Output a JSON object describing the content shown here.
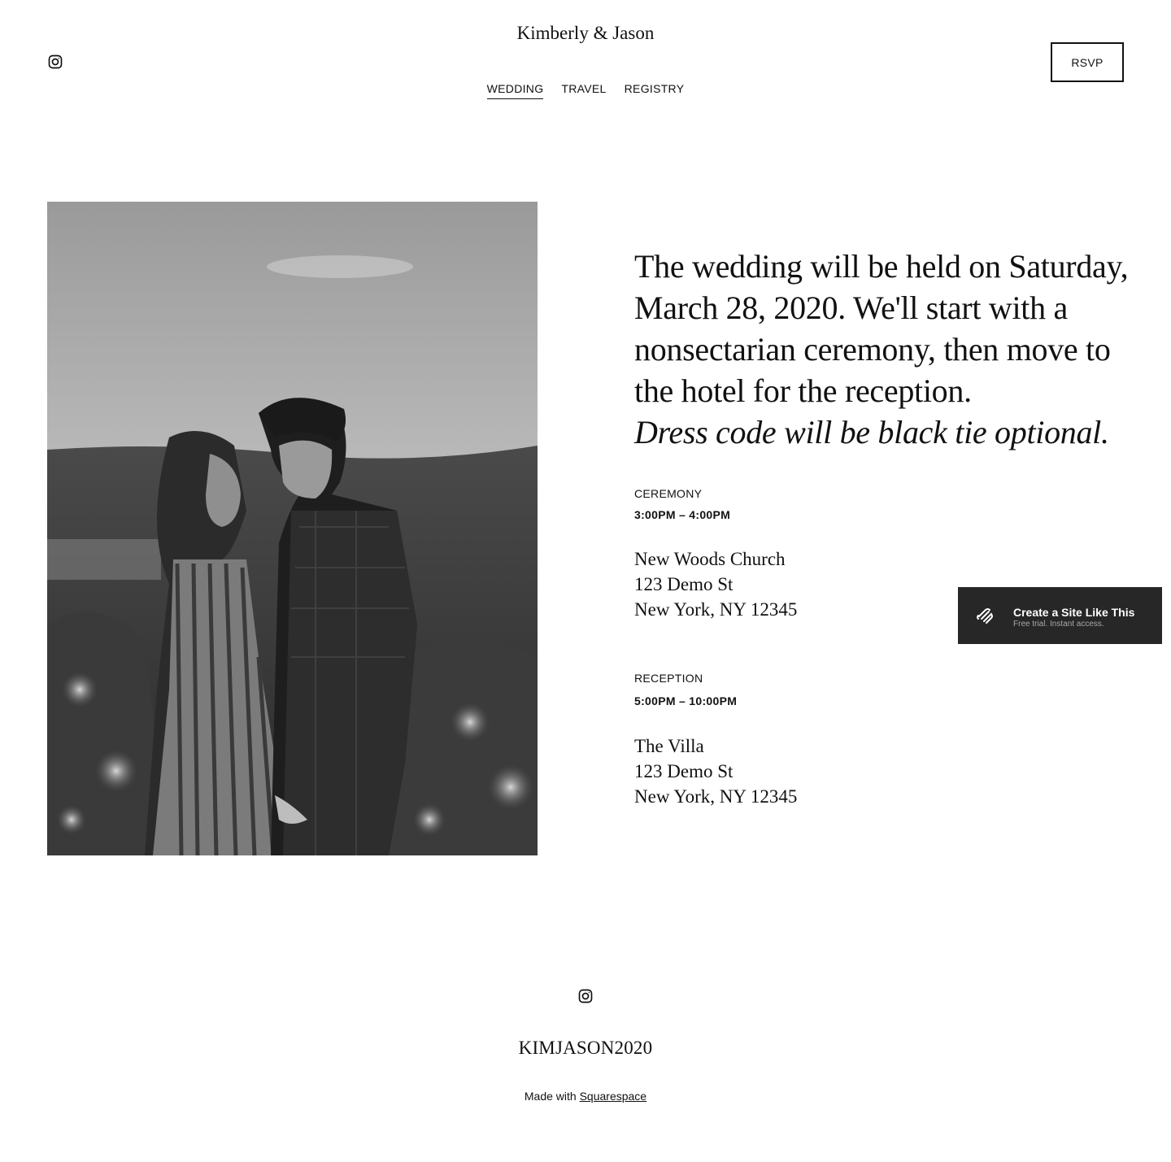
{
  "header": {
    "site_title": "Kimberly & Jason",
    "nav": [
      {
        "label": "WEDDING",
        "active": true
      },
      {
        "label": "TRAVEL",
        "active": false
      },
      {
        "label": "REGISTRY",
        "active": false
      }
    ],
    "rsvp_label": "RSVP",
    "social_icon": "instagram-icon"
  },
  "main": {
    "intro_text": "The wedding will be held on Saturday, March 28, 2020. We'll start with a nonsectarian ceremony, then move to the hotel for the reception.",
    "intro_italic": "Dress code will be black tie optional.",
    "ceremony": {
      "label": "CEREMONY",
      "time": "3:00PM – 4:00PM",
      "address": [
        "New Woods Church",
        "123 Demo St",
        "New York, NY 12345"
      ]
    },
    "reception": {
      "label": "RECEPTION",
      "time": "5:00PM – 10:00PM",
      "address": [
        "The Villa",
        "123 Demo St",
        "New York, NY 12345"
      ]
    }
  },
  "badge": {
    "title": "Create a Site Like This",
    "subtitle": "Free trial. Instant access.",
    "icon": "squarespace-logo-icon",
    "background": "#272727"
  },
  "footer": {
    "title": "KIMJASON2020",
    "made_with_prefix": "Made with",
    "made_with_link": "Squarespace",
    "social_icon": "instagram-icon"
  }
}
